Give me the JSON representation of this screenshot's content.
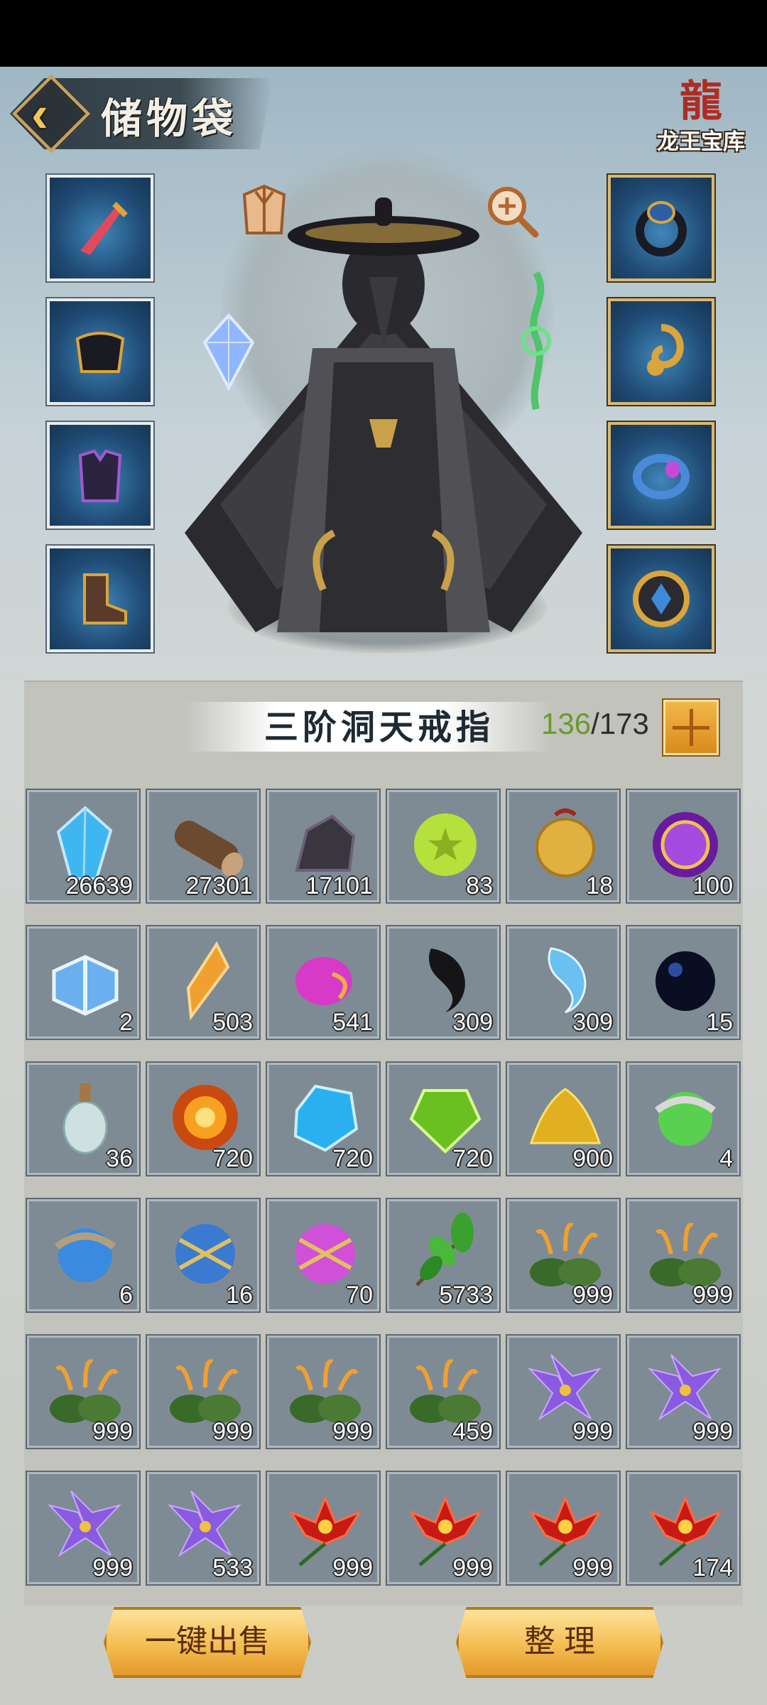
{
  "header": {
    "title": "储物袋",
    "treasury_label": "龙王宝库"
  },
  "bag": {
    "title": "三阶洞天戒指",
    "capacity_used": "136",
    "capacity_sep": "/",
    "capacity_total": "173"
  },
  "equipment": {
    "left": [
      "weapon-sword",
      "hat",
      "armor",
      "boots"
    ],
    "right": [
      "ring-sapphire",
      "dragon-amulet",
      "ring-amethyst",
      "coin-talisman"
    ]
  },
  "items": [
    {
      "icon": "blue-crystal",
      "count": "26639"
    },
    {
      "icon": "wood-log",
      "count": "27301"
    },
    {
      "icon": "dark-ore",
      "count": "17101"
    },
    {
      "icon": "star-pearl",
      "count": "83"
    },
    {
      "icon": "gold-pouch",
      "count": "18"
    },
    {
      "icon": "purple-orb",
      "count": "100"
    },
    {
      "icon": "gift-box",
      "count": "2"
    },
    {
      "icon": "amber-shard",
      "count": "503"
    },
    {
      "icon": "pink-egg",
      "count": "541"
    },
    {
      "icon": "yin-bead",
      "count": "309"
    },
    {
      "icon": "yang-bead",
      "count": "309"
    },
    {
      "icon": "black-pearl",
      "count": "15"
    },
    {
      "icon": "potion-gourd",
      "count": "36"
    },
    {
      "icon": "fire-orb",
      "count": "720"
    },
    {
      "icon": "ice-gem",
      "count": "720"
    },
    {
      "icon": "green-gem",
      "count": "720"
    },
    {
      "icon": "gold-dust",
      "count": "900"
    },
    {
      "icon": "green-scroll-orb",
      "count": "4"
    },
    {
      "icon": "blue-scroll-orb",
      "count": "6"
    },
    {
      "icon": "blue-sealed-orb",
      "count": "16"
    },
    {
      "icon": "pink-sealed-orb",
      "count": "70"
    },
    {
      "icon": "green-herb",
      "count": "5733"
    },
    {
      "icon": "lily-herb",
      "count": "999"
    },
    {
      "icon": "lily-herb",
      "count": "999"
    },
    {
      "icon": "lily-herb",
      "count": "999"
    },
    {
      "icon": "lily-herb",
      "count": "999"
    },
    {
      "icon": "lily-herb",
      "count": "999"
    },
    {
      "icon": "lily-herb",
      "count": "459"
    },
    {
      "icon": "purple-flower",
      "count": "999"
    },
    {
      "icon": "purple-flower",
      "count": "999"
    },
    {
      "icon": "purple-flower",
      "count": "999"
    },
    {
      "icon": "purple-flower",
      "count": "533"
    },
    {
      "icon": "red-lotus",
      "count": "999"
    },
    {
      "icon": "red-lotus",
      "count": "999"
    },
    {
      "icon": "red-lotus",
      "count": "999"
    },
    {
      "icon": "red-lotus",
      "count": "174"
    }
  ],
  "actions": {
    "sell_all": "一键出售",
    "sort": "整 理"
  },
  "colors": {
    "gold": "#f2b84a",
    "capacity_used": "#6a9a2a"
  }
}
